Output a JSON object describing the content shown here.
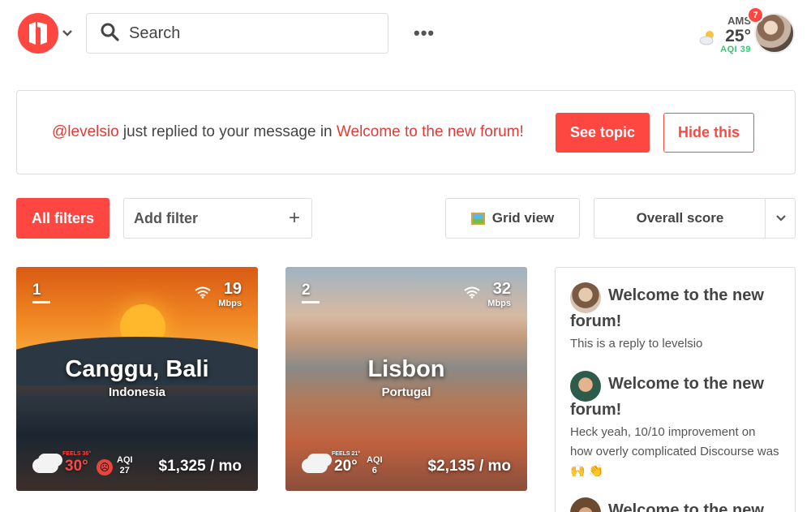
{
  "header": {
    "search_placeholder": "Search",
    "more_label": "•••",
    "weather": {
      "city": "AMS",
      "temp": "25°",
      "aqi": "AQI 39"
    },
    "notification_count": "7"
  },
  "notification": {
    "user": "@levelsio",
    "message": " just replied to your message in ",
    "topic": "Welcome to the new forum!",
    "see_label": "See topic",
    "hide_label": "Hide this"
  },
  "filters": {
    "all_label": "All filters",
    "add_label": "Add filter",
    "add_icon": "+",
    "grid_label": "Grid view",
    "sort_label": "Overall score"
  },
  "cities": [
    {
      "rank": "1",
      "speed": "19",
      "speed_unit": "Mbps",
      "name": "Canggu, Bali",
      "country": "Indonesia",
      "feels": "FEELS 36°",
      "temp": "30°",
      "aqi_label": "AQI",
      "aqi_value": "27",
      "price": "$1,325 / mo"
    },
    {
      "rank": "2",
      "speed": "32",
      "speed_unit": "Mbps",
      "name": "Lisbon",
      "country": "Portugal",
      "feels": "FEELS 21°",
      "temp": "20°",
      "aqi_label": "AQI",
      "aqi_value": "6",
      "price": "$2,135 / mo"
    }
  ],
  "forum": [
    {
      "title": "Welcome to the new forum!",
      "body": "This is a reply to levelsio"
    },
    {
      "title": "Welcome to the new forum!",
      "body": "Heck yeah, 10/10 improvement on how overly complicated Discourse was 🙌 👏"
    },
    {
      "title": "Welcome to the new",
      "body": ""
    }
  ],
  "colors": {
    "accent": "#ff4742",
    "aqi_good": "#2ecc71",
    "feels_hot": "#ff4742"
  },
  "icons": [
    "logo-icon",
    "chevron-down-icon",
    "search-icon",
    "more-icon",
    "weather-icon",
    "wifi-icon",
    "cloud-icon",
    "grid-view-icon",
    "plus-icon"
  ]
}
